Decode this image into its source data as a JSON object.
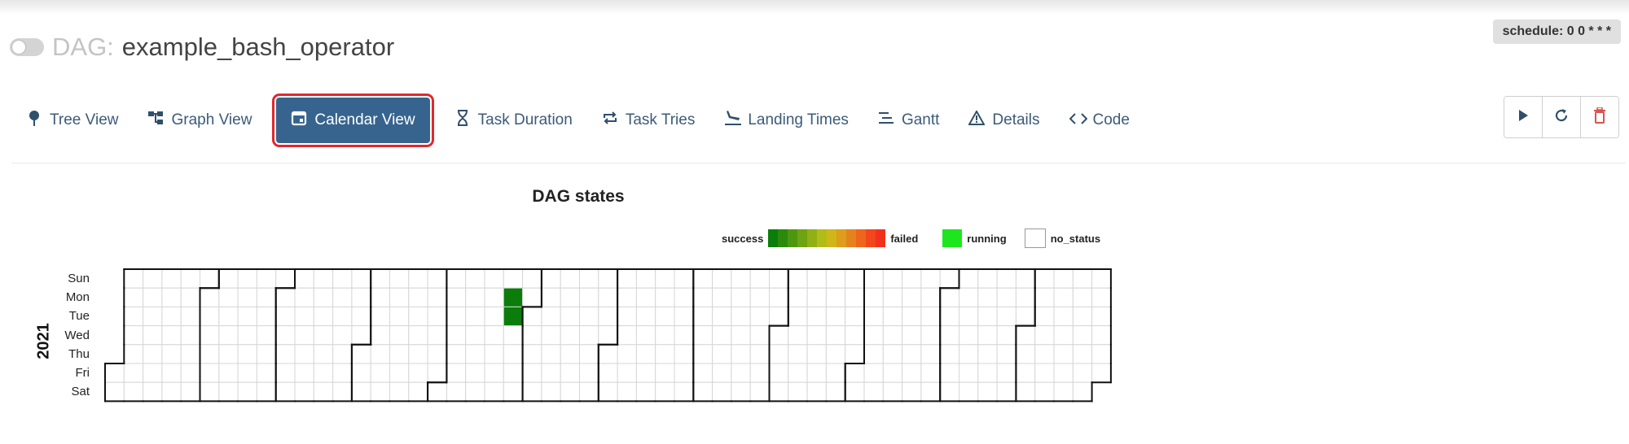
{
  "header": {
    "dag_prefix": "DAG:",
    "dag_id": "example_bash_operator",
    "schedule": "schedule: 0 0 * * *"
  },
  "nav": {
    "tabs": [
      {
        "label": "Tree View",
        "icon": "tree-icon"
      },
      {
        "label": "Graph View",
        "icon": "graph-icon"
      },
      {
        "label": "Calendar View",
        "icon": "calendar-icon",
        "active": true
      },
      {
        "label": "Task Duration",
        "icon": "hourglass-icon"
      },
      {
        "label": "Task Tries",
        "icon": "retry-arrows-icon"
      },
      {
        "label": "Landing Times",
        "icon": "plane-landing-icon"
      },
      {
        "label": "Gantt",
        "icon": "gantt-icon"
      },
      {
        "label": "Details",
        "icon": "warning-icon"
      },
      {
        "label": "Code",
        "icon": "code-icon"
      }
    ]
  },
  "actions": [
    {
      "icon": "play-icon"
    },
    {
      "icon": "refresh-icon"
    },
    {
      "icon": "trash-icon",
      "color": "#d9534f"
    }
  ],
  "calendar": {
    "title": "DAG states",
    "year": "2021",
    "days": [
      "Sun",
      "Mon",
      "Tue",
      "Wed",
      "Thu",
      "Fri",
      "Sat"
    ],
    "legend": {
      "success_label": "success",
      "failed_label": "failed",
      "running_label": "running",
      "no_status_label": "no_status",
      "gradient": [
        "#0a7d0a",
        "#2b8a0c",
        "#4d970f",
        "#6ea312",
        "#90b014",
        "#b2bc17",
        "#cfb619",
        "#de9d1a",
        "#e6821b",
        "#ed661b",
        "#f2461c",
        "#f2311c"
      ],
      "running_color": "#1ee61e"
    },
    "colors": {
      "success": "#0a7d0a",
      "grid": "#d6d6d6",
      "month_border": "#111111"
    },
    "success_dates": [
      "2021-05-24",
      "2021-05-25"
    ]
  }
}
